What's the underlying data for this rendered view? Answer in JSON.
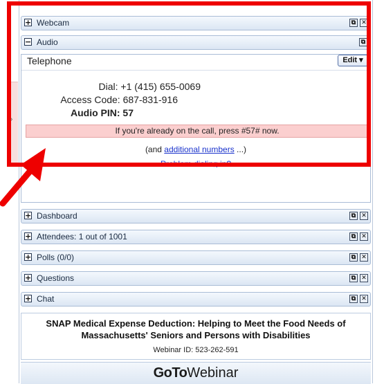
{
  "panels": {
    "webcam": {
      "label": "Webcam",
      "toggle": "+"
    },
    "audio": {
      "label": "Audio",
      "toggle": "−"
    },
    "dashboard": {
      "label": "Dashboard",
      "toggle": "+"
    },
    "attendees": {
      "label": "Attendees:  1 out of 1001",
      "toggle": "+"
    },
    "polls": {
      "label": "Polls (0/0)",
      "toggle": "+"
    },
    "questions": {
      "label": "Questions",
      "toggle": "+"
    },
    "chat": {
      "label": "Chat",
      "toggle": "+"
    }
  },
  "controls": {
    "popout_glyph": "⧉",
    "close_glyph": "✕"
  },
  "audio": {
    "mode": "Telephone",
    "edit_label": "Edit ▾",
    "dial": "Dial: +1 (415) 655-0069",
    "access_code": "Access Code: 687-831-916",
    "pin_label": "Audio PIN: 57",
    "notice": "If you're already on the call, press #57# now.",
    "additional_prefix": "(and ",
    "additional_link": "additional numbers",
    "additional_suffix": " ...)",
    "problem_link": "Problem dialing in?"
  },
  "webinar": {
    "title": "SNAP Medical Expense Deduction: Helping to Meet the Food Needs of Massachusetts' Seniors and Persons with Disabilities",
    "id": "Webinar ID: 523-262-591"
  },
  "brand": {
    "goto": "GoTo",
    "webinar": "Webinar"
  },
  "side_tab": {
    "arrow": "›"
  },
  "colors": {
    "highlight": "#ee0000",
    "notice_bg": "#fbcfcf",
    "link": "#1a33cc"
  }
}
